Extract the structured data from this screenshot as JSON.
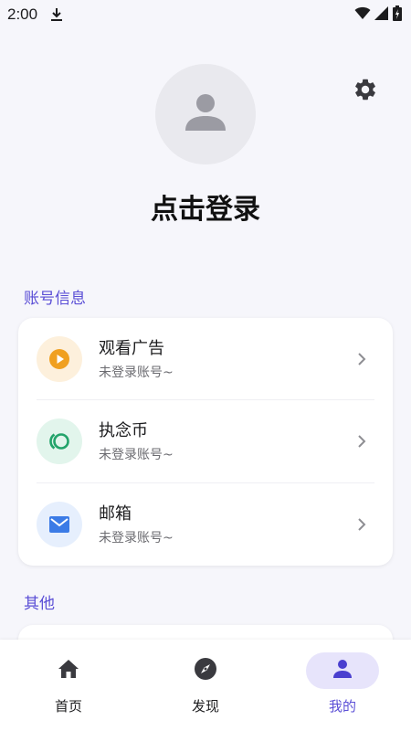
{
  "status_bar": {
    "time": "2:00",
    "icons": [
      "download-icon",
      "wifi-icon",
      "signal-icon",
      "battery-charging-icon"
    ]
  },
  "header": {
    "login_label": "点击登录",
    "avatar_icon": "person-icon",
    "settings_icon": "gear-icon"
  },
  "sections": {
    "account_title": "账号信息",
    "other_title": "其他"
  },
  "account_items": [
    {
      "title": "观看广告",
      "subtitle": "未登录账号~",
      "icon": "play-circle-icon",
      "icon_color": "#f0a020"
    },
    {
      "title": "执念币",
      "subtitle": "未登录账号~",
      "icon": "coin-icon",
      "icon_color": "#22a36a"
    },
    {
      "title": "邮箱",
      "subtitle": "未登录账号~",
      "icon": "mail-icon",
      "icon_color": "#3b7be6"
    }
  ],
  "bottom_nav": {
    "items": [
      {
        "label": "首页",
        "icon": "home-icon"
      },
      {
        "label": "发现",
        "icon": "compass-icon"
      },
      {
        "label": "我的",
        "icon": "person-icon",
        "active": true
      }
    ]
  },
  "colors": {
    "accent": "#5b4fd6",
    "background": "#f6f6fb",
    "card": "#ffffff"
  }
}
